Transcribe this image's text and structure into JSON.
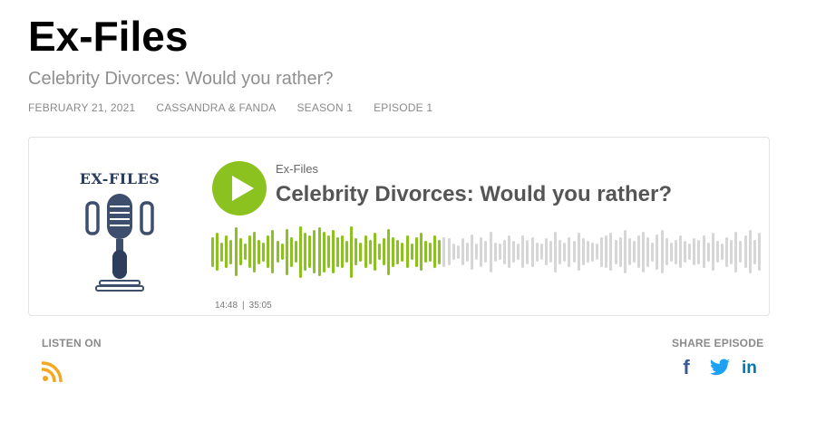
{
  "page": {
    "title": "Ex-Files",
    "subtitle": "Celebrity Divorces: Would you rather?",
    "meta": {
      "date": "FEBRUARY 21, 2021",
      "hosts": "CASSANDRA & FANDA",
      "season": "SEASON 1",
      "episode": "EPISODE 1"
    }
  },
  "player": {
    "cover_text": "EX-FILES",
    "show_name": "Ex-Files",
    "episode_title": "Celebrity Divorces: Would you rather?",
    "current_time": "14:48",
    "separator": "|",
    "duration": "35:05",
    "progress": 0.42,
    "colors": {
      "accent": "#8cc21f",
      "played_bar": "#8cc21f",
      "unplayed_bar": "#d6d6d6"
    },
    "waveform_levels": [
      0.55,
      0.7,
      0.35,
      0.6,
      0.45,
      0.9,
      0.5,
      0.3,
      0.6,
      0.75,
      0.45,
      0.35,
      0.6,
      0.8,
      0.4,
      0.3,
      0.85,
      0.55,
      0.4,
      0.95,
      0.7,
      0.6,
      0.8,
      0.9,
      0.75,
      0.6,
      0.8,
      0.55,
      0.6,
      0.4,
      0.95,
      0.5,
      0.35,
      0.6,
      0.45,
      0.7,
      0.3,
      0.5,
      0.85,
      0.55,
      0.45,
      0.35,
      0.6,
      0.3,
      0.55,
      0.7,
      0.4,
      0.35,
      0.6,
      0.45,
      0.55,
      0.5,
      0.3,
      0.25,
      0.5,
      0.35,
      0.65,
      0.3,
      0.55,
      0.4,
      0.75,
      0.35,
      0.3,
      0.45,
      0.6,
      0.4,
      0.3,
      0.6,
      0.45,
      0.55,
      0.35,
      0.3,
      0.5,
      0.4,
      0.75,
      0.45,
      0.35,
      0.55,
      0.4,
      0.7,
      0.5,
      0.4,
      0.35,
      0.3,
      0.55,
      0.6,
      0.7,
      0.45,
      0.55,
      0.8,
      0.5,
      0.4,
      0.6,
      0.75,
      0.55,
      0.35,
      0.65,
      0.8,
      0.5,
      0.35,
      0.45,
      0.6,
      0.4,
      0.3,
      0.5,
      0.45,
      0.6,
      0.35,
      0.7,
      0.4,
      0.3,
      0.55,
      0.45,
      0.75,
      0.4,
      0.6,
      0.8,
      0.45,
      0.7
    ]
  },
  "footer": {
    "listen_label": "LISTEN ON",
    "listen_icons": [
      "rss-icon"
    ],
    "share_label": "SHARE EPISODE",
    "share_icons": [
      "facebook-icon",
      "twitter-icon",
      "linkedin-icon"
    ],
    "facebook_glyph": "f",
    "linkedin_glyph": "in",
    "colors": {
      "rss": "#f5a623",
      "facebook": "#3b5998",
      "twitter": "#1da1f2",
      "linkedin": "#0077b5"
    }
  }
}
